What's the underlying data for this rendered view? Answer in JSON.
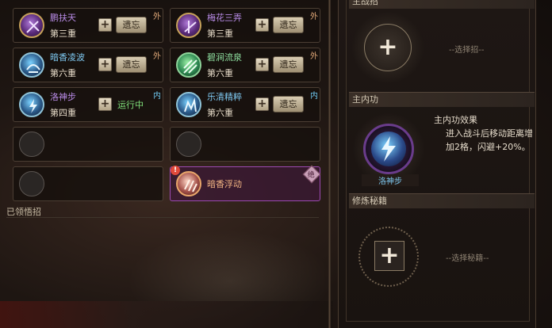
{
  "skills": [
    {
      "name": "鹏扶天",
      "level": "第三重",
      "tag": "外",
      "forget": "遗忘",
      "plus": "+",
      "color": "purple"
    },
    {
      "name": "梅花三弄",
      "level": "第三重",
      "tag": "外",
      "forget": "遗忘",
      "plus": "+",
      "color": "purple"
    },
    {
      "name": "暗香凌波",
      "level": "第六重",
      "tag": "外",
      "forget": "遗忘",
      "plus": "+",
      "color": "cyan"
    },
    {
      "name": "碧涧流泉",
      "level": "第六重",
      "tag": "外",
      "forget": "遗忘",
      "plus": "+",
      "color": "green"
    },
    {
      "name": "洛神步",
      "level": "第四重",
      "tag": "内",
      "status": "运行中",
      "plus": "+",
      "color": "cyan"
    },
    {
      "name": "乐清精粹",
      "level": "第六重",
      "tag": "内",
      "forget": "遗忘",
      "plus": "+",
      "color": "cyan"
    },
    {
      "name": "暗香浮动",
      "tag": "绝",
      "alert": "!",
      "color": "peach"
    }
  ],
  "learned_label": "已领悟招",
  "right": {
    "top_header": "主战招",
    "top_hint": "--选择招--",
    "inner_header": "主内功",
    "inner_skill_name": "洛神步",
    "effect_title": "主内功效果",
    "effect_text": "进入战斗后移动距离增加2格，闪避+20%。",
    "book_header": "修炼秘籍",
    "book_hint": "--选择秘籍--",
    "plus": "+"
  },
  "icons": [
    "plus-icon",
    "lightning-icon",
    "sword-icon",
    "spell-icon"
  ]
}
